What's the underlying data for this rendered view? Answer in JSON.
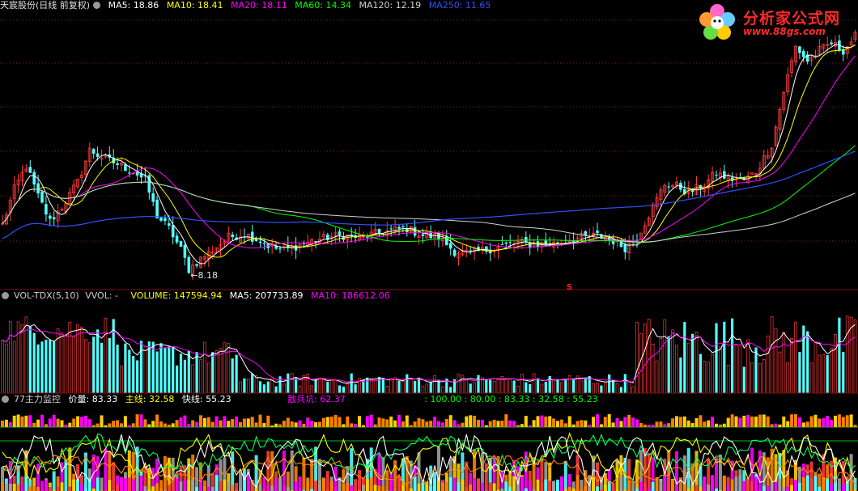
{
  "main_header": {
    "title": "天宸股份(日线 前复权)",
    "items": [
      {
        "label": "MA5: 18.86",
        "color": "#ffffff"
      },
      {
        "label": "MA10: 18.41",
        "color": "#ffff00"
      },
      {
        "label": "MA20: 18.11",
        "color": "#ff00ff"
      },
      {
        "label": "MA60: 14.34",
        "color": "#00ff00"
      },
      {
        "label": "MA120: 12.19",
        "color": "#d0d0d0"
      },
      {
        "label": "MA250: 11.65",
        "color": "#3050ff"
      }
    ]
  },
  "logo": {
    "name": "分析家公式网",
    "url": "www.88gs.com"
  },
  "vol_header": {
    "items": [
      {
        "label": "VOL-TDX(5,10)",
        "color": "#d0d0d0"
      },
      {
        "label": "VVOL: -",
        "color": "#d0d0d0"
      },
      {
        "label": "VOLUME: 147594.94",
        "color": "#ffff00"
      },
      {
        "label": "MA5: 207733.89",
        "color": "#ffffff"
      },
      {
        "label": "MA10: 186612.06",
        "color": "#ff00ff"
      }
    ]
  },
  "ind_header": {
    "items": [
      {
        "label": "77主力监控",
        "color": "#d0d0d0"
      },
      {
        "label": "价量: 83.33",
        "color": "#ffffff"
      },
      {
        "label": "主线: 32.58",
        "color": "#ffff00"
      },
      {
        "label": "快线: 55.23",
        "color": "#ffffff"
      },
      {
        "label": "散兵坑: 62.37",
        "color": "#ff00ff"
      },
      {
        "label": ": 100.00 : 80.00 : 83.33 : 32.58 : 55.23",
        "color": "#00ff00"
      }
    ]
  },
  "chart_data": [
    {
      "type": "candlestick",
      "title": "天宸股份(日线 前复权)",
      "ylim": [
        7.5,
        23.0
      ],
      "annotations": [
        {
          "text": "←8.18",
          "index": 47,
          "value": 8.18
        }
      ],
      "markers": [
        {
          "text": "S",
          "index": 143
        }
      ],
      "ma_series": [
        "MA5",
        "MA10",
        "MA20",
        "MA60",
        "MA120",
        "MA250"
      ],
      "close_path": [
        {
          "i": 0,
          "v": 11.0
        },
        {
          "i": 3,
          "v": 13.0
        },
        {
          "i": 6,
          "v": 14.3
        },
        {
          "i": 9,
          "v": 12.6
        },
        {
          "i": 12,
          "v": 11.2
        },
        {
          "i": 15,
          "v": 12.0
        },
        {
          "i": 19,
          "v": 13.4
        },
        {
          "i": 22,
          "v": 15.2
        },
        {
          "i": 25,
          "v": 14.8
        },
        {
          "i": 29,
          "v": 14.4
        },
        {
          "i": 33,
          "v": 14.0
        },
        {
          "i": 36,
          "v": 13.5
        },
        {
          "i": 39,
          "v": 11.5
        },
        {
          "i": 42,
          "v": 10.8
        },
        {
          "i": 45,
          "v": 9.6
        },
        {
          "i": 47,
          "v": 8.5
        },
        {
          "i": 50,
          "v": 9.1
        },
        {
          "i": 53,
          "v": 9.6
        },
        {
          "i": 57,
          "v": 10.3
        },
        {
          "i": 61,
          "v": 10.5
        },
        {
          "i": 65,
          "v": 10.1
        },
        {
          "i": 68,
          "v": 9.7
        },
        {
          "i": 71,
          "v": 9.6
        },
        {
          "i": 74,
          "v": 9.8
        },
        {
          "i": 78,
          "v": 10.1
        },
        {
          "i": 82,
          "v": 10.3
        },
        {
          "i": 86,
          "v": 10.4
        },
        {
          "i": 90,
          "v": 10.3
        },
        {
          "i": 94,
          "v": 10.5
        },
        {
          "i": 98,
          "v": 10.7
        },
        {
          "i": 102,
          "v": 10.8
        },
        {
          "i": 106,
          "v": 10.4
        },
        {
          "i": 110,
          "v": 10.3
        },
        {
          "i": 114,
          "v": 9.5
        },
        {
          "i": 118,
          "v": 9.4
        },
        {
          "i": 122,
          "v": 9.6
        },
        {
          "i": 126,
          "v": 9.8
        },
        {
          "i": 130,
          "v": 10.0
        },
        {
          "i": 134,
          "v": 9.9
        },
        {
          "i": 138,
          "v": 9.9
        },
        {
          "i": 142,
          "v": 10.1
        },
        {
          "i": 146,
          "v": 10.3
        },
        {
          "i": 150,
          "v": 10.4
        },
        {
          "i": 154,
          "v": 10.1
        },
        {
          "i": 157,
          "v": 9.7
        },
        {
          "i": 160,
          "v": 10.3
        },
        {
          "i": 164,
          "v": 12.0
        },
        {
          "i": 167,
          "v": 13.3
        },
        {
          "i": 170,
          "v": 13.2
        },
        {
          "i": 173,
          "v": 12.8
        },
        {
          "i": 177,
          "v": 13.3
        },
        {
          "i": 180,
          "v": 13.9
        },
        {
          "i": 183,
          "v": 13.6
        },
        {
          "i": 187,
          "v": 13.5
        },
        {
          "i": 190,
          "v": 14.0
        },
        {
          "i": 194,
          "v": 15.5
        },
        {
          "i": 197,
          "v": 18.5
        },
        {
          "i": 200,
          "v": 21.0
        },
        {
          "i": 203,
          "v": 20.2
        },
        {
          "i": 206,
          "v": 20.8
        },
        {
          "i": 209,
          "v": 21.2
        },
        {
          "i": 212,
          "v": 20.8
        },
        {
          "i": 215,
          "v": 21.6
        }
      ]
    },
    {
      "type": "bar",
      "title": "VOL-TDX(5,10)",
      "series": [
        "VOLUME",
        "MA5",
        "MA10"
      ],
      "last": {
        "VOLUME": 147594.94,
        "MA5": 207733.89,
        "MA10": 186612.06
      }
    },
    {
      "type": "line",
      "title": "77主力监控",
      "series": [
        {
          "name": "价量",
          "last": 83.33
        },
        {
          "name": "主线",
          "last": 32.58
        },
        {
          "name": "快线",
          "last": 55.23
        },
        {
          "name": "散兵坑",
          "last": 62.37
        }
      ],
      "reference_lines": [
        100.0,
        80.0
      ]
    }
  ]
}
